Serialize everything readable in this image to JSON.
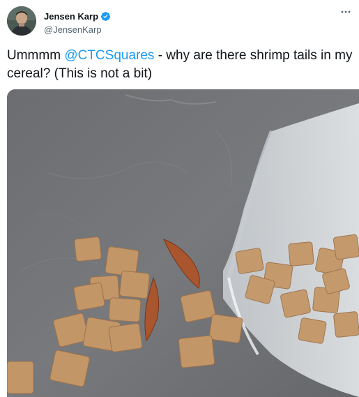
{
  "author": {
    "display_name": "Jensen Karp",
    "handle": "@JensenKarp",
    "verified_icon": "verified-badge-icon",
    "avatar_icon": "avatar"
  },
  "more_icon": "more-options-icon",
  "tweet": {
    "text_before": "Ummmm ",
    "mention": "@CTCSquares",
    "text_after": " - why are there shrimp tails in my cereal? (This is not a bit)"
  },
  "colors": {
    "accent": "#1d9bf0",
    "text": "#0f1419",
    "secondary": "#536471"
  }
}
